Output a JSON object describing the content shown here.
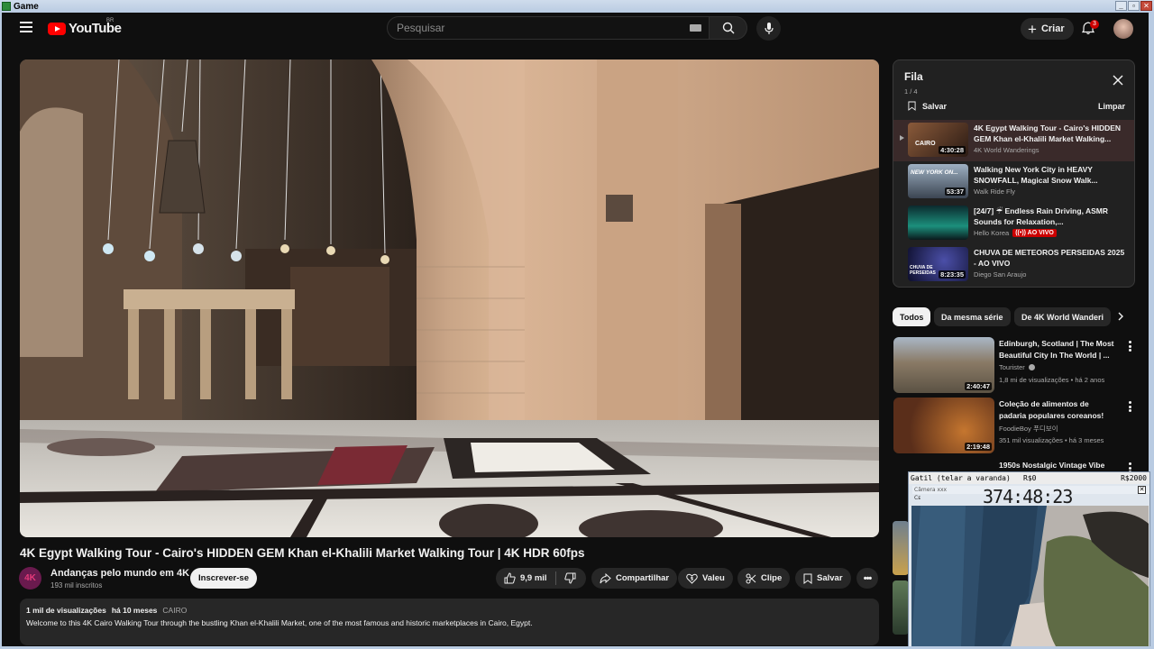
{
  "window": {
    "title": "Game"
  },
  "header": {
    "logo_text": "YouTube",
    "country_code": "BR",
    "search_placeholder": "Pesquisar",
    "create_label": "Criar",
    "notification_count": "3"
  },
  "video": {
    "title": "4K Egypt Walking Tour - Cairo's HIDDEN GEM Khan el-Khalili Market Walking Tour | 4K HDR 60fps",
    "channel": {
      "avatar_text": "4K",
      "name": "Andanças pelo mundo em 4K",
      "subscribers": "193 mil inscritos",
      "subscribe_label": "Inscrever-se"
    },
    "actions": {
      "likes": "9,9 mil",
      "share": "Compartilhar",
      "thanks": "Valeu",
      "clip": "Clipe",
      "save": "Salvar"
    },
    "description": {
      "views": "1 mil de visualizações",
      "age": "há 10 meses",
      "tag": "CAIRO",
      "text": "Welcome to this 4K Cairo Walking Tour through the bustling Khan el-Khalili Market, one of the most famous and historic marketplaces in Cairo, Egypt."
    }
  },
  "queue": {
    "title": "Fila",
    "position": "1 / 4",
    "save_label": "Salvar",
    "clear_label": "Limpar",
    "items": [
      {
        "title": "4K Egypt Walking Tour - Cairo's HIDDEN GEM Khan el-Khalili Market Walking...",
        "channel": "4K World Wanderings",
        "duration": "4:30:28",
        "thumb_text": "CAIRO",
        "live": ""
      },
      {
        "title": "Walking New York City in HEAVY SNOWFALL, Magical Snow Walk...",
        "channel": "Walk Ride Fly",
        "duration": "53:37",
        "thumb_text": "NEW YORK ON...",
        "live": ""
      },
      {
        "title": "[24/7] ☔ Endless Rain Driving, ASMR Sounds for Relaxation,...",
        "channel": "Hello Korea",
        "duration": "",
        "thumb_text": "",
        "live": "((•)) AO VIVO"
      },
      {
        "title": "CHUVA DE METEOROS PERSEIDAS 2025 - AO VIVO",
        "channel": "Diego San Araujo",
        "duration": "8:23:35",
        "thumb_text": "CHUVA DE PERSEIDAS",
        "live": ""
      }
    ]
  },
  "filters": {
    "chips": [
      "Todos",
      "Da mesma série",
      "De 4K World Wanderi"
    ]
  },
  "recommendations": [
    {
      "title": "Edinburgh, Scotland | The Most Beautiful City In The World | ...",
      "channel": "Tourister",
      "meta": "1,8 mi de visualizações • há 2 anos",
      "duration": "2:40:47"
    },
    {
      "title": "Coleção de alimentos de padaria populares coreanos!",
      "channel": "FoodieBoy 푸디보이",
      "meta": "351 mil visualizações • há 3 meses",
      "duration": "2:19:48"
    },
    {
      "title": "1950s Nostalgic Vintage Vibe",
      "channel": "",
      "meta": "",
      "duration": ""
    }
  ],
  "overlay": {
    "bar_left": "Gatil (telar a varanda)",
    "bar_mid": "R$0",
    "bar_right": "R$2000",
    "inner_title": "Câmera xxx",
    "timer": "374:48:23",
    "small_label": "Cᴇ"
  },
  "colors": {
    "background": "#0f0f0f",
    "surface": "#272727",
    "brand_red": "#ff0000",
    "live_red": "#cc0000"
  }
}
